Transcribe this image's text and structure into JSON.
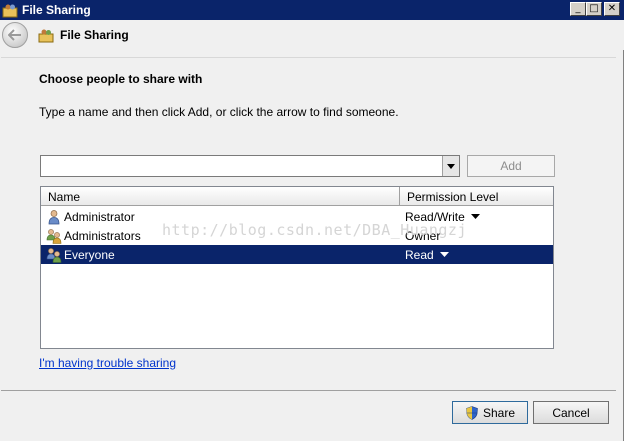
{
  "window": {
    "title": "File Sharing",
    "controls": {
      "minimize": "_",
      "maximize": "□",
      "close": "✕"
    }
  },
  "header": {
    "title": "File Sharing",
    "back_icon": "back-arrow-icon"
  },
  "main": {
    "heading": "Choose people to share with",
    "instruction": "Type a name and then click Add, or click the arrow to find someone.",
    "name_input": {
      "value": "",
      "placeholder": ""
    },
    "add_label": "Add"
  },
  "list": {
    "columns": [
      "Name",
      "Permission Level"
    ],
    "rows": [
      {
        "name": "Administrator",
        "permission": "Read/Write",
        "has_dropdown": true,
        "selected": false,
        "icon": "user-icon"
      },
      {
        "name": "Administrators",
        "permission": "Owner",
        "has_dropdown": false,
        "selected": false,
        "icon": "group-icon"
      },
      {
        "name": "Everyone",
        "permission": "Read",
        "has_dropdown": true,
        "selected": true,
        "icon": "group-icon"
      }
    ]
  },
  "watermark": "http://blog.csdn.net/DBA_Huangzj",
  "trouble_link": "I'm having trouble sharing",
  "footer": {
    "share_label": "Share",
    "cancel_label": "Cancel"
  },
  "colors": {
    "titlebar": "#0a246a",
    "selection": "#0a246a",
    "link": "#0033cc"
  }
}
